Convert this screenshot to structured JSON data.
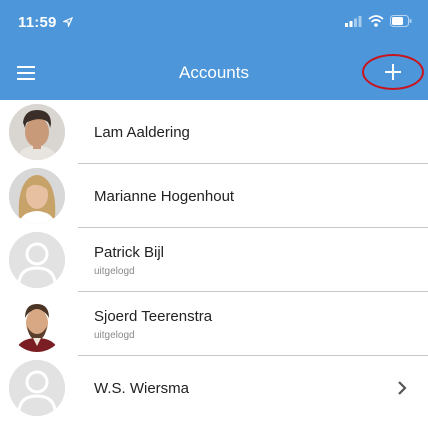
{
  "status_bar": {
    "time": "11:59",
    "icons": [
      "location-arrow-icon",
      "signal-icon",
      "wifi-icon",
      "battery-icon"
    ]
  },
  "nav": {
    "title": "Accounts",
    "menu_icon": "hamburger-menu-icon",
    "add_icon": "plus-icon",
    "add_highlight_color": "#c8141e",
    "bar_color": "#4c96d9"
  },
  "accounts": [
    {
      "name": "Lam Aaldering",
      "status": ""
    },
    {
      "name": "Marianne Hogenhout",
      "status": ""
    },
    {
      "name": "Patrick Bijl",
      "status": "uitgelogd"
    },
    {
      "name": "Sjoerd Teerenstra",
      "status": "uitgelogd"
    },
    {
      "name": "W.S. Wiersma",
      "status": ""
    }
  ]
}
